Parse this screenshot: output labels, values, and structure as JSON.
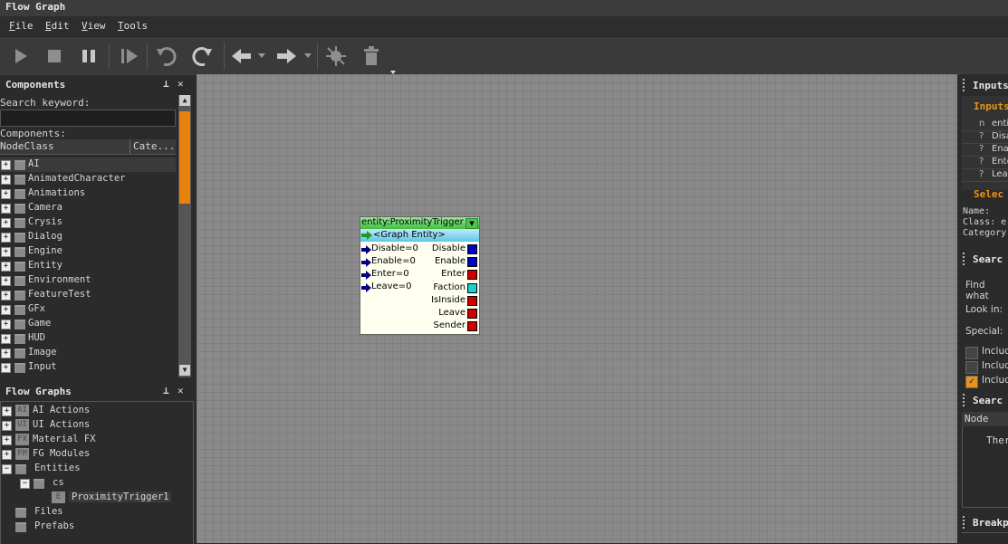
{
  "window": {
    "title": "Flow Graph"
  },
  "menu": {
    "file": "ile",
    "file_key": "F",
    "edit": "dit",
    "edit_key": "E",
    "view": "iew",
    "view_key": "V",
    "tools": "ools",
    "tools_key": "T"
  },
  "components": {
    "title": "Components",
    "search_label": "Search keyword:",
    "list_label": "Components:",
    "col_nodeclass": "NodeClass",
    "col_category": "Cate...",
    "items": [
      "AI",
      "AnimatedCharacter",
      "Animations",
      "Camera",
      "Crysis",
      "Dialog",
      "Engine",
      "Entity",
      "Environment",
      "FeatureTest",
      "GFx",
      "Game",
      "HUD",
      "Image",
      "Input"
    ]
  },
  "flowgraphs": {
    "title": "Flow Graphs",
    "items": [
      {
        "label": "AI Actions",
        "badge": "AI"
      },
      {
        "label": "UI Actions",
        "badge": "UI"
      },
      {
        "label": "Material FX",
        "badge": "FX"
      },
      {
        "label": "FG Modules",
        "badge": "FM"
      },
      {
        "label": "Entities"
      },
      {
        "label": "cs"
      },
      {
        "label": "ProximityTrigger1",
        "badge": "E"
      },
      {
        "label": "Files"
      },
      {
        "label": "Prefabs"
      }
    ]
  },
  "node": {
    "title": "entity:ProximityTrigger",
    "entity": "<Graph Entity>",
    "inputs": [
      "Disable=0",
      "Enable=0",
      "Enter=0",
      "Leave=0"
    ],
    "outputs": [
      {
        "label": "Disable",
        "color": "#0000c8"
      },
      {
        "label": "Enable",
        "color": "#0000c8"
      },
      {
        "label": "Enter",
        "color": "#d00000"
      },
      {
        "label": "Faction",
        "color": "#20d0d0"
      },
      {
        "label": "IsInside",
        "color": "#d00000"
      },
      {
        "label": "Leave",
        "color": "#d00000"
      },
      {
        "label": "Sender",
        "color": "#d00000"
      }
    ]
  },
  "right": {
    "inputs_title": "Inputs",
    "inputs_sub": "Inputs",
    "input_rows": [
      {
        "type": "n",
        "name": "enti"
      },
      {
        "type": "?",
        "name": "Disa"
      },
      {
        "type": "?",
        "name": "Ena"
      },
      {
        "type": "?",
        "name": "Ente"
      },
      {
        "type": "?",
        "name": "Lea"
      }
    ],
    "selected_title": "Selec",
    "name_label": "Name:",
    "class_label": "Class: e",
    "category_label": "Category",
    "search_title": "Searc",
    "find_label": "Find what",
    "lookin_label": "Look in:",
    "special_label": "Special:",
    "includes": [
      "Includ",
      "Includ",
      "Includ"
    ],
    "search_results_title": "Searc",
    "node_col": "Node",
    "there": "Ther",
    "breakpoints_title": "Breakp"
  }
}
